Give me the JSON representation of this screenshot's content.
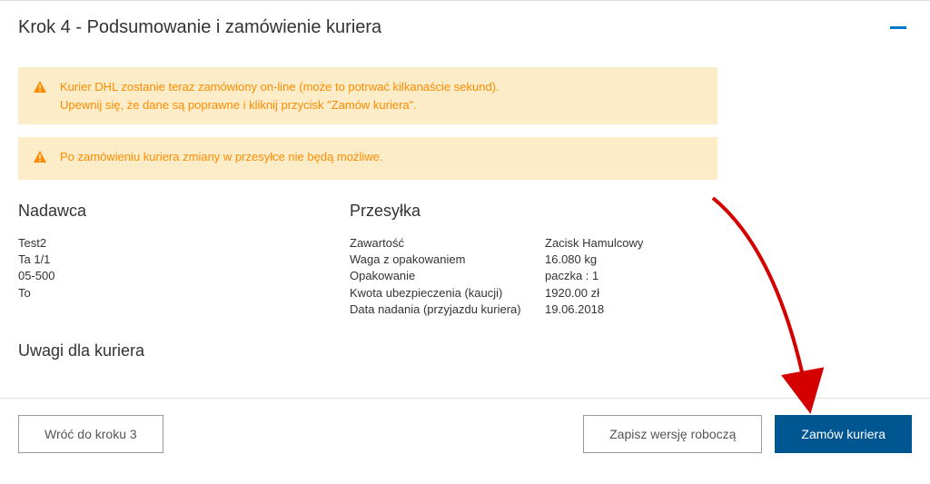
{
  "header": {
    "title": "Krok 4 - Podsumowanie i zamówienie kuriera"
  },
  "alerts": {
    "primary_line1": "Kurier DHL zostanie teraz zamówiony on-line (może to potrwać kilkanaście sekund).",
    "primary_line2": "Upewnij się, że dane są poprawne i kliknij przycisk \"Zamów kuriera\".",
    "secondary": "Po zamówieniu kuriera zmiany w przesyłce nie będą możliwe."
  },
  "sender": {
    "heading": "Nadawca",
    "line1": "Test2",
    "line2": "Ta 1/1",
    "line3": "05-500",
    "line4": "To"
  },
  "shipment": {
    "heading": "Przesyłka",
    "rows": {
      "contents_label": "Zawartość",
      "contents_value": "Zacisk Hamulcowy",
      "weight_label": "Waga z opakowaniem",
      "weight_value": "16.080 kg",
      "packaging_label": "Opakowanie",
      "packaging_value": "paczka : 1",
      "insurance_label": "Kwota ubezpieczenia (kaucji)",
      "insurance_value": "1920.00 zł",
      "date_label": "Data nadania (przyjazdu kuriera)",
      "date_value": "19.06.2018"
    }
  },
  "notes": {
    "heading": "Uwagi dla kuriera"
  },
  "buttons": {
    "back": "Wróć do kroku 3",
    "save_draft": "Zapisz wersję roboczą",
    "order": "Zamów kuriera"
  }
}
